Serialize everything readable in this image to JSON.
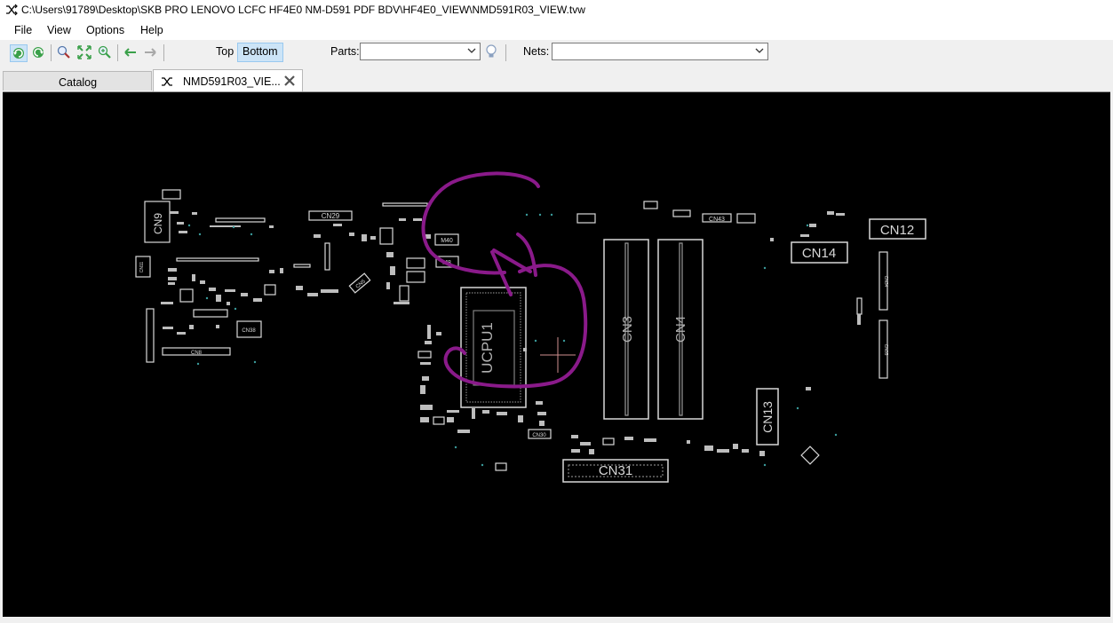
{
  "window": {
    "title": "C:\\Users\\91789\\Desktop\\SKB PRO LENOVO LCFC HF4E0 NM-D591 PDF BDV\\HF4E0_VIEW\\NMD591R03_VIEW.tvw",
    "icon": "shuffle-icon"
  },
  "menu": [
    "File",
    "View",
    "Options",
    "Help"
  ],
  "toolbar": {
    "buttons": [
      "rotate-left-icon",
      "rotate-right-icon",
      "zoom-icon",
      "fit-icon",
      "zoom-in-icon",
      "back-arrow-icon",
      "forward-arrow-icon"
    ],
    "side_top": "Top",
    "side_bottom": "Bottom",
    "active_side": "Bottom",
    "parts_label": "Parts:",
    "parts_value": "",
    "search_icon": "bulb-icon",
    "nets_label": "Nets:",
    "nets_value": ""
  },
  "tabs": [
    {
      "label": "Catalog",
      "active": false
    },
    {
      "label": "NMD591R03_VIE...",
      "active": true,
      "icon": "shuffle-icon",
      "close": "close-icon"
    }
  ],
  "board": {
    "background": "#000000",
    "outline_color": "#d8d8d8",
    "annotation_color": "#8a1a8a",
    "cursor_color": "#d09090",
    "labels": {
      "cn9": "CN9",
      "cn29": "CN29",
      "cn11": "CN11",
      "cn38": "CN38",
      "cn8": "CN8",
      "cn5": "CN5",
      "m40": "M40",
      "m8": "M8",
      "ucpu1": "UCPU1",
      "cn3": "CN3",
      "cn4": "CN4",
      "cn43": "CN43",
      "cn12": "CN12",
      "cn14": "CN14",
      "cn13": "CN13",
      "cn31": "CN31",
      "cn30": "CN30",
      "cn34": "CN34",
      "cn35": "CN35"
    }
  }
}
